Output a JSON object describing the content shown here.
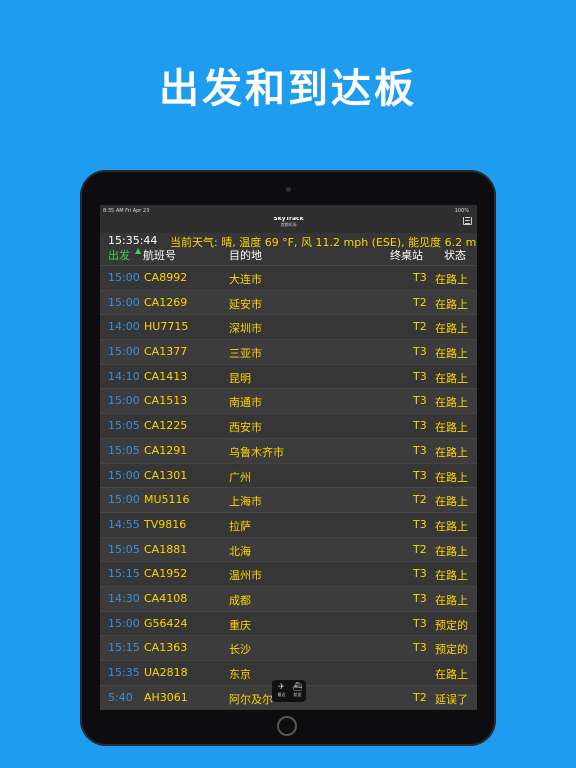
{
  "promo": {
    "headline": "出发和到达板"
  },
  "statusbar": {
    "time": "8:35 AM  Fri Apr 23",
    "battery": "100%"
  },
  "app": {
    "title": "SkyTrack",
    "subtitle": "首都机场"
  },
  "info": {
    "clock": "15:35:44",
    "weather": "当前天气: 晴, 温度 69 °F, 风 11.2 mph (ESE), 能见度 6.2 m"
  },
  "columns": {
    "departures": "出发",
    "sort_arrow": "▲",
    "flight": "航班号",
    "destination": "目的地",
    "terminal": "终桌站",
    "status": "状态"
  },
  "flights": [
    {
      "time": "15:00",
      "flight": "CA8992",
      "dest": "大连市",
      "term": "T3",
      "status": "在路上"
    },
    {
      "time": "15:00",
      "flight": "CA1269",
      "dest": "延安市",
      "term": "T2",
      "status": "在路上"
    },
    {
      "time": "14:00",
      "flight": "HU7715",
      "dest": "深圳市",
      "term": "T2",
      "status": "在路上"
    },
    {
      "time": "15:00",
      "flight": "CA1377",
      "dest": "三亚市",
      "term": "T3",
      "status": "在路上"
    },
    {
      "time": "14:10",
      "flight": "CA1413",
      "dest": "昆明",
      "term": "T3",
      "status": "在路上"
    },
    {
      "time": "15:00",
      "flight": "CA1513",
      "dest": "南通市",
      "term": "T3",
      "status": "在路上"
    },
    {
      "time": "15:05",
      "flight": "CA1225",
      "dest": "西安市",
      "term": "T3",
      "status": "在路上"
    },
    {
      "time": "15:05",
      "flight": "CA1291",
      "dest": "乌鲁木齐市",
      "term": "T3",
      "status": "在路上"
    },
    {
      "time": "15:00",
      "flight": "CA1301",
      "dest": "广州",
      "term": "T3",
      "status": "在路上"
    },
    {
      "time": "15:00",
      "flight": "MU5116",
      "dest": "上海市",
      "term": "T2",
      "status": "在路上"
    },
    {
      "time": "14:55",
      "flight": "TV9816",
      "dest": "拉萨",
      "term": "T3",
      "status": "在路上"
    },
    {
      "time": "15:05",
      "flight": "CA1881",
      "dest": "北海",
      "term": "T2",
      "status": "在路上"
    },
    {
      "time": "15:15",
      "flight": "CA1952",
      "dest": "温州市",
      "term": "T3",
      "status": "在路上"
    },
    {
      "time": "14:30",
      "flight": "CA4108",
      "dest": "成都",
      "term": "T3",
      "status": "在路上"
    },
    {
      "time": "15:00",
      "flight": "G56424",
      "dest": "重庆",
      "term": "T3",
      "status": "预定的"
    },
    {
      "time": "15:15",
      "flight": "CA1363",
      "dest": "长沙",
      "term": "T3",
      "status": "预定的"
    },
    {
      "time": "15:35",
      "flight": "UA2818",
      "dest": "东京",
      "term": "",
      "status": "在路上"
    },
    {
      "time": "5:40",
      "flight": "AH3061",
      "dest": "阿尔及尔",
      "term": "T2",
      "status": "延误了"
    }
  ],
  "tabbar": [
    {
      "icon": "departure-plane-icon",
      "glyph": "✈",
      "label": "最近"
    },
    {
      "icon": "ship-icon",
      "glyph": "⛴",
      "label": "航班"
    }
  ]
}
